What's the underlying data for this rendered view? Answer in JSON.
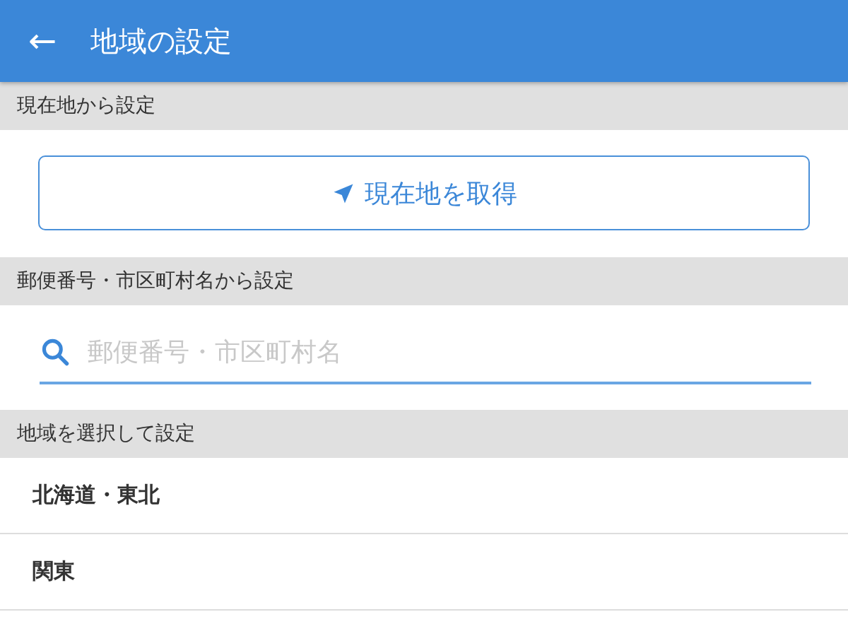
{
  "header": {
    "back": "←",
    "title": "地域の設定"
  },
  "sections": [
    {
      "kind": "button",
      "heading": "現在地から設定",
      "button": "現在地を取得"
    },
    {
      "kind": "search",
      "heading": "郵便番号・市区町村名から設定",
      "placeholder": "郵便番号・市区町村名"
    },
    {
      "kind": "list",
      "heading": "地域を選択して設定",
      "items": [
        "北海道・東北",
        "関東"
      ]
    }
  ]
}
